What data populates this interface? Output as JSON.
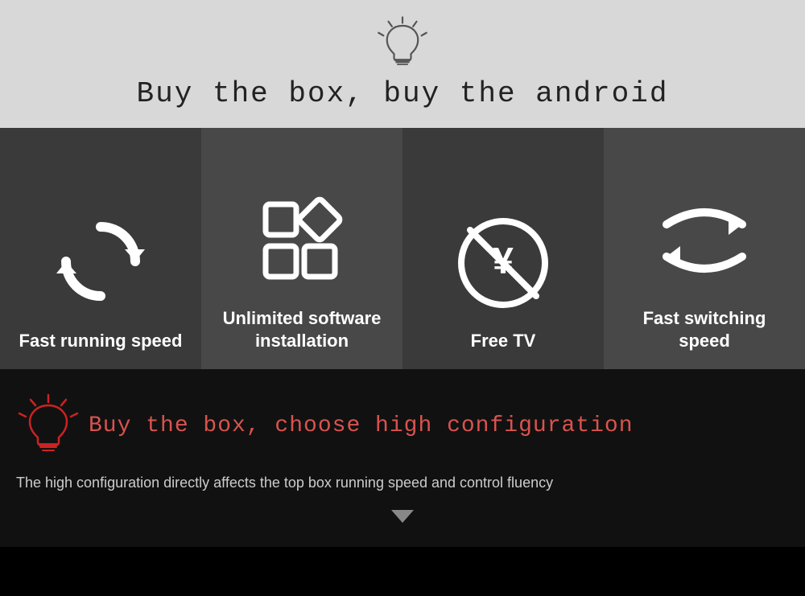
{
  "top": {
    "title": "Buy the box, buy the android"
  },
  "features": [
    {
      "id": "fast-running",
      "label": "Fast running speed",
      "icon": "sync"
    },
    {
      "id": "unlimited-software",
      "label": "Unlimited software installation",
      "icon": "apps"
    },
    {
      "id": "free-tv",
      "label": "Free TV",
      "icon": "no-yen"
    },
    {
      "id": "fast-switching",
      "label": "Fast switching speed",
      "icon": "switch"
    }
  ],
  "bottom": {
    "title": "Buy the box, choose high configuration",
    "description": "The high configuration directly affects the top box running speed and control fluency"
  }
}
